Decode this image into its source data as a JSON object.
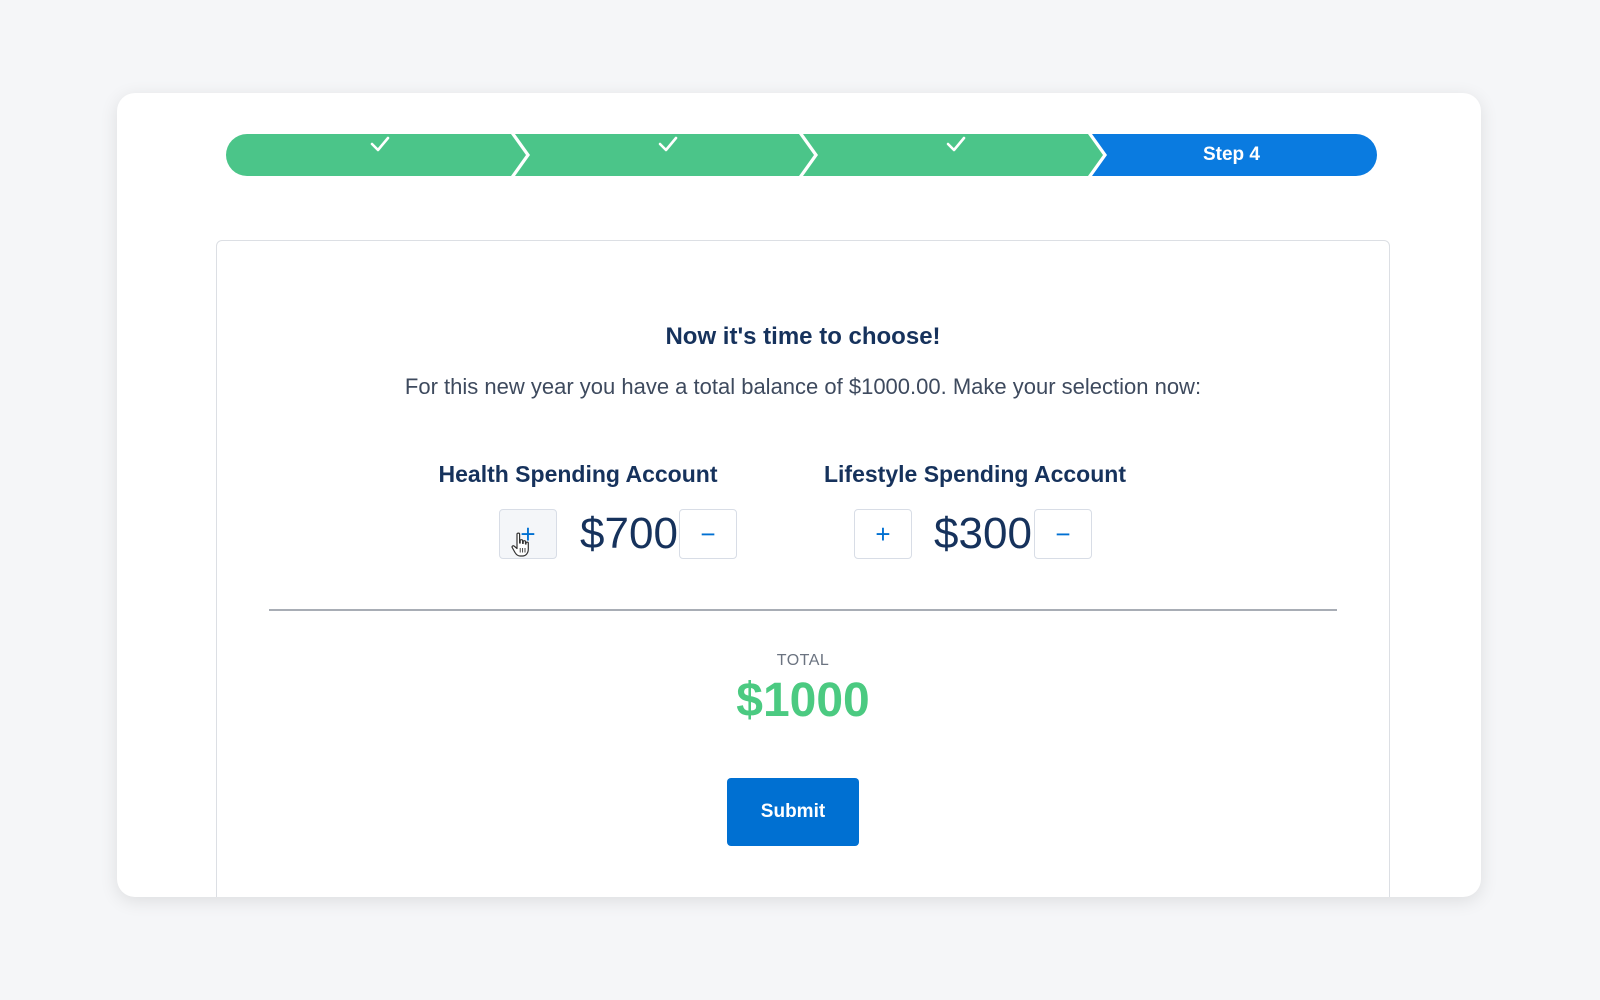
{
  "path": {
    "stages": [
      {
        "status": "complete",
        "icon": "check-icon"
      },
      {
        "status": "complete",
        "icon": "check-icon"
      },
      {
        "status": "complete",
        "icon": "check-icon"
      },
      {
        "status": "current",
        "label": "Step 4"
      }
    ],
    "colors": {
      "complete": "#4bc589",
      "current": "#0a7be0"
    }
  },
  "form": {
    "title": "Now it's time to choose!",
    "subtitle": "For this new year you have a total balance of $1000.00. Make your selection now:",
    "accounts": [
      {
        "title": "Health Spending Account",
        "amount": "$700",
        "increment_label": "+",
        "decrement_label": "−"
      },
      {
        "title": "Lifestyle Spending Account",
        "amount": "$300",
        "increment_label": "+",
        "decrement_label": "−"
      }
    ],
    "total_label": "TOTAL",
    "total_value": "$1000",
    "submit_label": "Submit"
  },
  "colors": {
    "accent": "#0070d2",
    "total": "#4bca81",
    "text": "#16325c"
  }
}
